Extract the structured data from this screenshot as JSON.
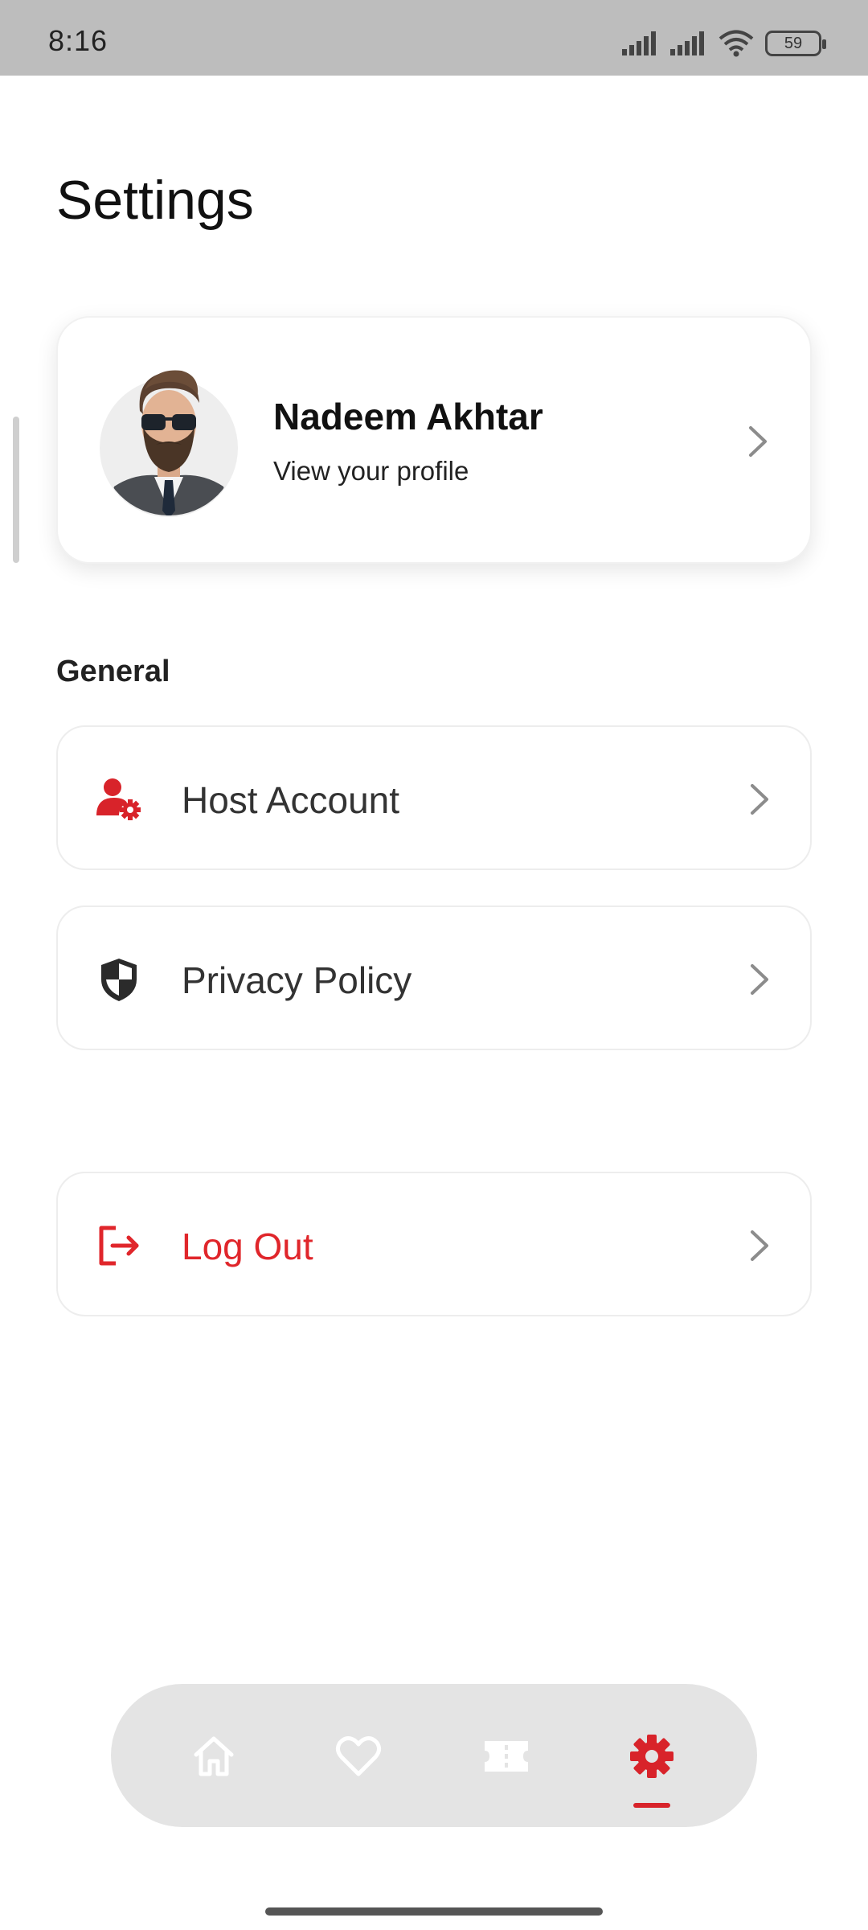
{
  "status_bar": {
    "time": "8:16",
    "battery": "59",
    "icons": [
      "signal-icon",
      "signal-icon",
      "wifi-icon",
      "battery-icon"
    ]
  },
  "page": {
    "title": "Settings"
  },
  "profile": {
    "name": "Nadeem Akhtar",
    "subtitle": "View your profile"
  },
  "general": {
    "label": "General",
    "items": [
      {
        "label": "Host Account",
        "icon": "user-gear-icon"
      },
      {
        "label": "Privacy Policy",
        "icon": "shield-icon"
      }
    ]
  },
  "logout": {
    "label": "Log Out",
    "icon": "logout-icon"
  },
  "bottom_nav": {
    "items": [
      {
        "icon": "home-icon",
        "active": false
      },
      {
        "icon": "heart-icon",
        "active": false
      },
      {
        "icon": "ticket-icon",
        "active": false
      },
      {
        "icon": "gear-icon",
        "active": true
      }
    ]
  },
  "colors": {
    "accent": "#d8232a",
    "status_bar_bg": "#bdbdbd",
    "nav_bg": "#e4e4e4",
    "nav_icon_inactive": "#ffffff"
  }
}
